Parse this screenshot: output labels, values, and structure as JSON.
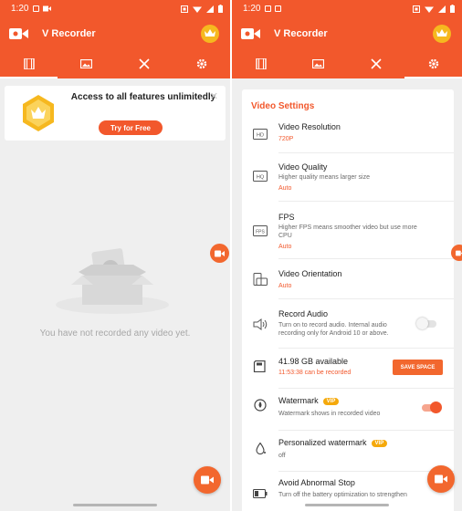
{
  "status_bar": {
    "time": "1:20"
  },
  "app": {
    "title": "V Recorder"
  },
  "tabs": [
    {
      "name": "videos",
      "icon": "film-icon"
    },
    {
      "name": "images",
      "icon": "image-icon"
    },
    {
      "name": "tools",
      "icon": "tools-icon"
    },
    {
      "name": "settings",
      "icon": "gear-icon"
    }
  ],
  "left_screen": {
    "promo": {
      "title": "Access to all features unlimitedly",
      "button": "Try for Free"
    },
    "empty_message": "You have not recorded any video yet."
  },
  "right_screen": {
    "heading": "Video Settings",
    "rows": {
      "resolution": {
        "title": "Video Resolution",
        "value": "720P",
        "icon": "hd-icon"
      },
      "quality": {
        "title": "Video Quality",
        "desc": "Higher quality means larger size",
        "value": "Auto",
        "icon": "quality-icon"
      },
      "fps": {
        "title": "FPS",
        "desc": "Higher FPS means smoother video but use more CPU",
        "value": "Auto",
        "icon": "fps-icon"
      },
      "orientation": {
        "title": "Video Orientation",
        "value": "Auto",
        "icon": "orientation-icon"
      },
      "audio": {
        "title": "Record Audio",
        "desc": "Turn on to record audio. Internal audio recording only for Android 10 or above.",
        "icon": "speaker-icon",
        "enabled": false
      },
      "storage": {
        "title": "41.98 GB available",
        "value": "11:53:38 can be recorded",
        "button": "SAVE SPACE",
        "icon": "sd-card-icon"
      },
      "watermark": {
        "title": "Watermark",
        "badge": "VIP",
        "desc": "Watermark shows in recorded video",
        "icon": "watermark-icon",
        "enabled": true
      },
      "personal_watermark": {
        "title": "Personalized watermark",
        "badge": "VIP",
        "desc": "off",
        "icon": "drop-icon"
      },
      "abnormal_stop": {
        "title": "Avoid Abnormal Stop",
        "desc": "Turn off the battery optimization to strengthen",
        "icon": "battery-icon"
      }
    }
  },
  "colors": {
    "accent": "#f2582c",
    "fab": "#f2672e",
    "crown": "#f6b81f",
    "vip_badge": "#f5a90b",
    "background": "#efefef"
  }
}
